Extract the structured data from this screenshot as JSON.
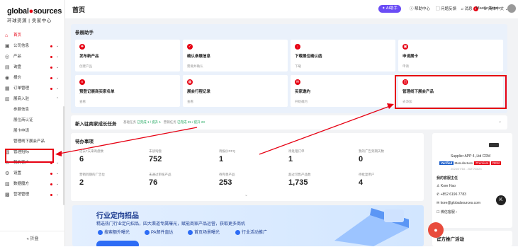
{
  "logo": {
    "brand_a": "global",
    "brand_b": "sources",
    "brand_c": "环球资源 | 卖家中心"
  },
  "sidebar": {
    "items": [
      {
        "label": "首页",
        "icon": "home-icon",
        "glyph": "⌂"
      },
      {
        "label": "公司信息",
        "icon": "company-icon",
        "glyph": "▣"
      },
      {
        "label": "产品",
        "icon": "product-icon",
        "glyph": "◎"
      },
      {
        "label": "询盘",
        "icon": "inquiry-icon",
        "glyph": "▤"
      },
      {
        "label": "报价",
        "icon": "quote-icon",
        "glyph": "◉"
      },
      {
        "label": "订单管理",
        "icon": "order-icon",
        "glyph": "▦"
      },
      {
        "label": "展商入驻",
        "icon": "exhibitor-icon",
        "glyph": "▥"
      },
      {
        "label": "参展信息"
      },
      {
        "label": "展位商认证"
      },
      {
        "label": "展卡申请"
      },
      {
        "label": "管理线下展会产品"
      },
      {
        "label": "管理招标",
        "icon": "tender-icon",
        "glyph": "▧"
      },
      {
        "label": "我的客户",
        "icon": "customer-icon",
        "glyph": "♙"
      },
      {
        "label": "设置",
        "icon": "settings-icon",
        "glyph": "⚙"
      },
      {
        "label": "数据魔方",
        "icon": "data-icon",
        "glyph": "▨"
      },
      {
        "label": "营销管理",
        "icon": "marketing-icon",
        "glyph": "▩"
      }
    ],
    "collapse": "« 折叠"
  },
  "topbar": {
    "title": "首页",
    "ai": "AI助手",
    "help": "帮助中心",
    "feedback": "问题反馈",
    "messages": "消息",
    "message_count": "7",
    "language": "简体中文",
    "account": "Master Acco..."
  },
  "assistant": {
    "title": "参展助手",
    "cards": [
      {
        "title": "发布新产品",
        "sub": "创建产品"
      },
      {
        "title": "确认参展信息",
        "sub": "需要并确认"
      },
      {
        "title": "下载展位确认函",
        "sub": "下载"
      },
      {
        "title": "申请展卡",
        "sub": "申请"
      },
      {
        "title": "预登记展商买家名单",
        "sub": "查看"
      },
      {
        "title": "展会行程记录",
        "sub": "查看"
      },
      {
        "title": "买家邀约",
        "sub": "开始邀约"
      },
      {
        "title": "管理线下展会产品",
        "sub": "去添加"
      }
    ]
  },
  "growth": {
    "title": "新入驻商家成长任务",
    "s1": "基础任务",
    "s1v": "已完成 1 / 提升 1",
    "s2": "营销任务",
    "s2v": "已完成 25 / 提升 23"
  },
  "todo": {
    "title": "待办事项",
    "stats": [
      {
        "label": "过去7天来询盘数",
        "value": "6"
      },
      {
        "label": "未读询盘",
        "value": "752"
      },
      {
        "label": "待报价RFQ",
        "value": "1"
      },
      {
        "label": "待处理订单",
        "value": "1"
      },
      {
        "label": "我的广告到期天数",
        "value": "0"
      },
      {
        "label": "营销到期的广告位",
        "value": "2"
      },
      {
        "label": "未通过审核产品",
        "value": "76"
      },
      {
        "label": "待完善产品",
        "value": "253"
      },
      {
        "label": "超过可售产品数",
        "value": "1,735"
      },
      {
        "label": "待批复用户",
        "value": "4"
      }
    ]
  },
  "banner": {
    "title": "行业定向招品",
    "sub": "精选热门行业定向招品，四大渠道专属曝光，赋能商家产品运营，获取更多商机",
    "tags": [
      "搜索额外曝光",
      "PA邮件直达",
      "首页场景曝光",
      "行业活动推广"
    ]
  },
  "account_card": {
    "company": "Supplier APP 4.,Ltd CRM",
    "verified": "Verified",
    "manufacturer": "Manufacturer",
    "tag1": "Premium",
    "tag2": "OEM",
    "dates": "2024/07/18 - 2027/03/23",
    "manager_title": "我的客服主任",
    "name": "Kore Hao",
    "phone": "+852 6196 7783",
    "email": "kore@globalsources.com",
    "chat": "微信客服 ›",
    "activity": "官方推广活动"
  },
  "colors": {
    "brand": "#e60012",
    "ai": "#6a4cf5",
    "banner": "#1a3a8f"
  }
}
